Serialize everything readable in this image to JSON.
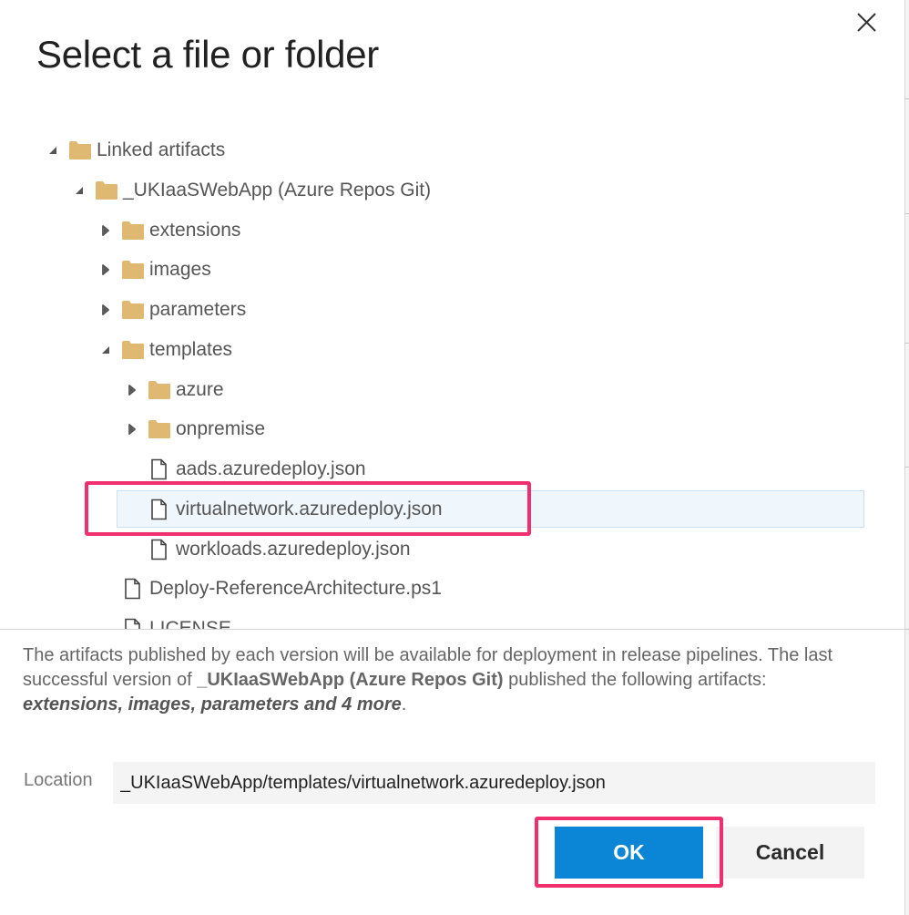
{
  "dialog": {
    "title": "Select a file or folder"
  },
  "icons": {
    "close": "close-icon",
    "expanded": "caret-down-icon",
    "collapsed": "caret-right-icon",
    "folder": "folder-icon",
    "file": "file-icon"
  },
  "colors": {
    "primary_button": "#0b86d7",
    "folder": "#dfb871",
    "highlight": "#f0306e",
    "selected_row": "#eff6fc"
  },
  "tree": {
    "items": [
      {
        "label": "Linked artifacts",
        "type": "folder",
        "state": "expanded",
        "level": 0,
        "selected": false
      },
      {
        "label": "_UKIaaSWebApp (Azure Repos Git)",
        "type": "folder",
        "state": "expanded",
        "level": 1,
        "selected": false
      },
      {
        "label": "extensions",
        "type": "folder",
        "state": "collapsed",
        "level": 2,
        "selected": false
      },
      {
        "label": "images",
        "type": "folder",
        "state": "collapsed",
        "level": 2,
        "selected": false
      },
      {
        "label": "parameters",
        "type": "folder",
        "state": "collapsed",
        "level": 2,
        "selected": false
      },
      {
        "label": "templates",
        "type": "folder",
        "state": "expanded",
        "level": 2,
        "selected": false
      },
      {
        "label": "azure",
        "type": "folder",
        "state": "collapsed",
        "level": 3,
        "selected": false
      },
      {
        "label": "onpremise",
        "type": "folder",
        "state": "collapsed",
        "level": 3,
        "selected": false
      },
      {
        "label": "aads.azuredeploy.json",
        "type": "file",
        "state": "none",
        "level": 3,
        "selected": false
      },
      {
        "label": "virtualnetwork.azuredeploy.json",
        "type": "file",
        "state": "none",
        "level": 3,
        "selected": true
      },
      {
        "label": "workloads.azuredeploy.json",
        "type": "file",
        "state": "none",
        "level": 3,
        "selected": false
      },
      {
        "label": "Deploy-ReferenceArchitecture.ps1",
        "type": "file",
        "state": "none",
        "level": 2,
        "selected": false
      },
      {
        "label": "LICENSE",
        "type": "file",
        "state": "none",
        "level": 2,
        "selected": false
      }
    ]
  },
  "info": {
    "part1": "The artifacts published by each version will be available for deployment in release pipelines. The last successful version of ",
    "repo": "_UKIaaSWebApp (Azure Repos Git)",
    "part2": " published the following artifacts: ",
    "artifacts": "extensions, images, parameters and 4 more",
    "part3": "."
  },
  "location": {
    "label": "Location",
    "value": "_UKIaaSWebApp/templates/virtualnetwork.azuredeploy.json"
  },
  "buttons": {
    "ok": "OK",
    "cancel": "Cancel"
  }
}
